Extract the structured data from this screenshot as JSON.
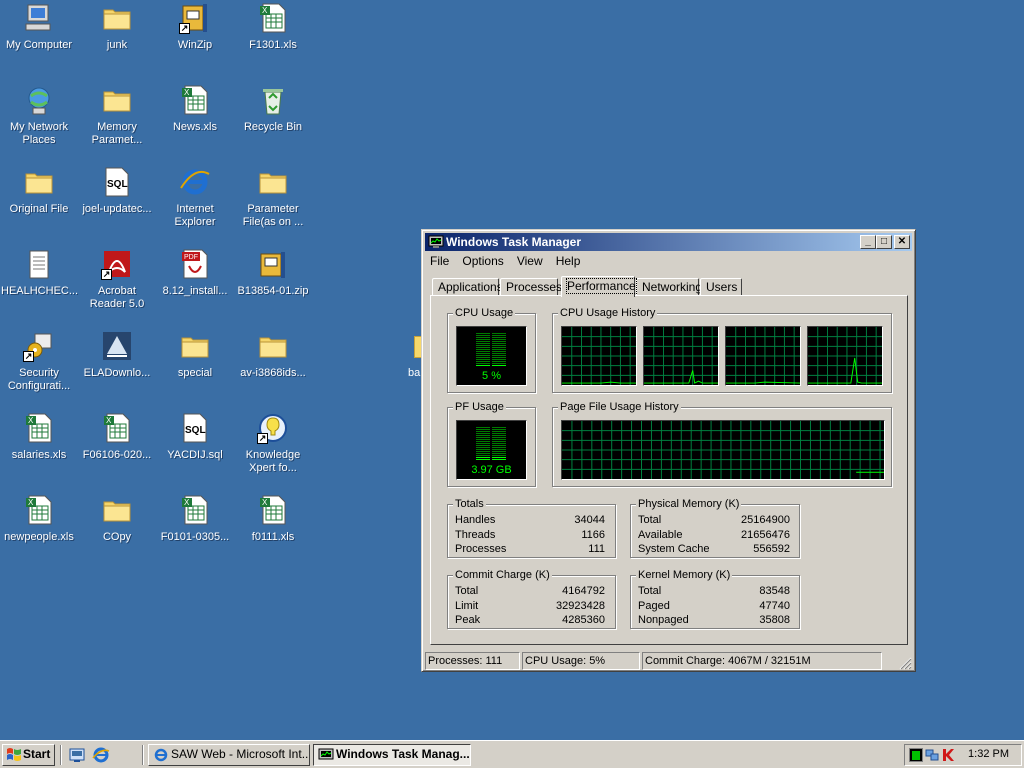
{
  "desktop": {
    "icons": [
      {
        "label": "My Computer",
        "icon": "my-computer-icon"
      },
      {
        "label": "junk",
        "icon": "folder-icon"
      },
      {
        "label": "WinZip",
        "icon": "winzip-icon"
      },
      {
        "label": "F1301.xls",
        "icon": "excel-file-icon"
      },
      {
        "label": "My Network Places",
        "icon": "network-places-icon"
      },
      {
        "label": "Memory Paramet...",
        "icon": "folder-icon"
      },
      {
        "label": "News.xls",
        "icon": "excel-file-icon"
      },
      {
        "label": "Recycle Bin",
        "icon": "recycle-bin-icon"
      },
      {
        "label": "Original File",
        "icon": "folder-icon"
      },
      {
        "label": "joel-updatec...",
        "icon": "sql-file-icon"
      },
      {
        "label": "Internet Explorer",
        "icon": "internet-explorer-icon"
      },
      {
        "label": "Parameter File(as on ...",
        "icon": "folder-icon"
      },
      {
        "label": "HEALHCHEC...",
        "icon": "text-file-icon"
      },
      {
        "label": "Acrobat Reader 5.0",
        "icon": "acrobat-reader-icon"
      },
      {
        "label": "8.12_install...",
        "icon": "pdf-file-icon"
      },
      {
        "label": "B13854-01.zip",
        "icon": "zip-file-icon"
      },
      {
        "label": "Security Configurati...",
        "icon": "security-config-icon"
      },
      {
        "label": "ELADownlo...",
        "icon": "download-app-icon"
      },
      {
        "label": "special",
        "icon": "folder-icon"
      },
      {
        "label": "av-i3868ids...",
        "icon": "folder-icon"
      },
      {
        "label": "salaries.xls",
        "icon": "excel-file-icon"
      },
      {
        "label": "F06106-020...",
        "icon": "excel-file-icon"
      },
      {
        "label": "YACDIJ.sql",
        "icon": "sql-file-icon"
      },
      {
        "label": "Knowledge Xpert fo...",
        "icon": "knowledge-xpert-icon"
      },
      {
        "label": "newpeople.xls",
        "icon": "excel-file-icon"
      },
      {
        "label": "COpy",
        "icon": "folder-icon"
      },
      {
        "label": "F0101-0305...",
        "icon": "excel-file-icon"
      },
      {
        "label": "f0111.xls",
        "icon": "excel-file-icon"
      }
    ],
    "hidden_icon_label": "ba"
  },
  "window": {
    "title": "Windows Task Manager",
    "controls": {
      "minimize": "_",
      "maximize": "□",
      "close": "✕"
    },
    "menu": [
      "File",
      "Options",
      "View",
      "Help"
    ],
    "tabs": [
      "Applications",
      "Processes",
      "Performance",
      "Networking",
      "Users"
    ],
    "active_tab": "Performance",
    "cpu_usage": {
      "title": "CPU Usage",
      "value": "5 %",
      "percent": 5
    },
    "cpu_history": {
      "title": "CPU Usage History",
      "cores": 4
    },
    "pf_usage": {
      "title": "PF Usage",
      "value": "3.97 GB",
      "percent": 12
    },
    "pf_history": {
      "title": "Page File Usage History"
    },
    "totals": {
      "title": "Totals",
      "rows": [
        {
          "label": "Handles",
          "value": "34044"
        },
        {
          "label": "Threads",
          "value": "1166"
        },
        {
          "label": "Processes",
          "value": "111"
        }
      ]
    },
    "physical_memory": {
      "title": "Physical Memory (K)",
      "rows": [
        {
          "label": "Total",
          "value": "25164900"
        },
        {
          "label": "Available",
          "value": "21656476"
        },
        {
          "label": "System Cache",
          "value": "556592"
        }
      ]
    },
    "commit_charge": {
      "title": "Commit Charge (K)",
      "rows": [
        {
          "label": "Total",
          "value": "4164792"
        },
        {
          "label": "Limit",
          "value": "32923428"
        },
        {
          "label": "Peak",
          "value": "4285360"
        }
      ]
    },
    "kernel_memory": {
      "title": "Kernel Memory (K)",
      "rows": [
        {
          "label": "Total",
          "value": "83548"
        },
        {
          "label": "Paged",
          "value": "47740"
        },
        {
          "label": "Nonpaged",
          "value": "35808"
        }
      ]
    },
    "statusbar": {
      "processes": "Processes: 111",
      "cpu": "CPU Usage: 5%",
      "commit": "Commit Charge: 4067M / 32151M"
    }
  },
  "taskbar": {
    "start_label": "Start",
    "buttons": [
      {
        "label": "SAW Web - Microsoft Int...",
        "active": false,
        "icon": "internet-explorer-icon"
      },
      {
        "label": "Windows Task Manag...",
        "active": true,
        "icon": "task-manager-icon"
      }
    ],
    "clock": "1:32 PM"
  },
  "colors": {
    "desktop": "#3a6ea5",
    "titlebar_start": "#0a246a",
    "titlebar_end": "#a6caf0",
    "graph_grid": "#008040",
    "graph_line": "#00ff00"
  }
}
